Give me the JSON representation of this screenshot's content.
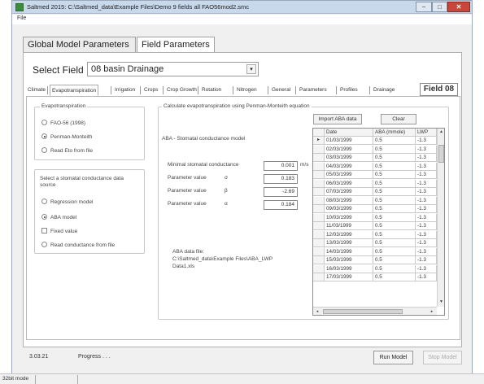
{
  "window": {
    "title": "Saltmed 2015: C:\\Saltmed_data\\Example Files\\Demo 9 fields all FAO56mod2.smc",
    "min_glyph": "−",
    "max_glyph": "□",
    "close_glyph": "✕"
  },
  "menu": {
    "file": "File"
  },
  "top_tabs": {
    "global": "Global Model Parameters",
    "field": "Field Parameters"
  },
  "select_field": {
    "label": "Select Field",
    "value": "08 basin Drainage",
    "arrow": "▾"
  },
  "sub_tabs": [
    "Climate",
    "Evapotranspiration",
    "Irrigation",
    "Crops",
    "Crop Growth",
    "Rotation",
    "Nitrogen",
    "General",
    "Parameters",
    "Profiles",
    "Drainage"
  ],
  "field_badge": "Field 08",
  "et_group": {
    "legend": "Evapotranspiration",
    "options": [
      "FAO-56 (1998)",
      "Penman-Monteith",
      "Read Eto from file"
    ],
    "selected_index": 1
  },
  "conductance_group": {
    "title": "Select a stomatal conductance data source",
    "options": [
      "Regression model",
      "ABA model",
      "Fixed value",
      "Read conductance from file"
    ],
    "selected_index": 1
  },
  "calc_group": {
    "legend": "Calculate evapotranspiration using Penman-Monteith equation",
    "model_title": "ABA - Stomatal conductance model",
    "params": [
      {
        "label": "Minimal stomatal conductance",
        "symbol": "",
        "value": "0.001",
        "unit": "m/s"
      },
      {
        "label": "Parameter value",
        "symbol": "σ",
        "value": "0.183",
        "unit": ""
      },
      {
        "label": "Parameter value",
        "symbol": "β",
        "value": "-2.69",
        "unit": ""
      },
      {
        "label": "Parameter value",
        "symbol": "α",
        "value": "0.184",
        "unit": ""
      }
    ],
    "aba_file_label": "ABA data file:",
    "aba_file_path_line1": "C:\\Saltmed_data\\Example Files\\ABA_LWP",
    "aba_file_path_line2": "Data1.xls",
    "import_button": "Import ABA data",
    "clear_button": "Clear"
  },
  "grid": {
    "columns": [
      "Date",
      "ABA (mmole)",
      "LWP"
    ],
    "rows": [
      {
        "date": "01/03/1999",
        "aba": "0.5",
        "lwp": "-1.3",
        "marker": "▸"
      },
      {
        "date": "02/03/1999",
        "aba": "0.5",
        "lwp": "-1.3",
        "marker": ""
      },
      {
        "date": "03/03/1999",
        "aba": "0.5",
        "lwp": "-1.3",
        "marker": ""
      },
      {
        "date": "04/03/1999",
        "aba": "0.5",
        "lwp": "-1.3",
        "marker": ""
      },
      {
        "date": "05/03/1999",
        "aba": "0.5",
        "lwp": "-1.3",
        "marker": ""
      },
      {
        "date": "06/03/1999",
        "aba": "0.5",
        "lwp": "-1.3",
        "marker": ""
      },
      {
        "date": "07/03/1999",
        "aba": "0.5",
        "lwp": "-1.3",
        "marker": ""
      },
      {
        "date": "08/03/1999",
        "aba": "0.5",
        "lwp": "-1.3",
        "marker": ""
      },
      {
        "date": "09/03/1999",
        "aba": "0.5",
        "lwp": "-1.3",
        "marker": ""
      },
      {
        "date": "10/03/1999",
        "aba": "0.5",
        "lwp": "-1.3",
        "marker": ""
      },
      {
        "date": "11/03/1999",
        "aba": "0.5",
        "lwp": "-1.3",
        "marker": ""
      },
      {
        "date": "12/03/1999",
        "aba": "0.5",
        "lwp": "-1.3",
        "marker": ""
      },
      {
        "date": "13/03/1999",
        "aba": "0.5",
        "lwp": "-1.3",
        "marker": ""
      },
      {
        "date": "14/03/1999",
        "aba": "0.5",
        "lwp": "-1.3",
        "marker": ""
      },
      {
        "date": "15/03/1999",
        "aba": "0.5",
        "lwp": "-1.3",
        "marker": ""
      },
      {
        "date": "16/03/1999",
        "aba": "0.5",
        "lwp": "-1.3",
        "marker": ""
      },
      {
        "date": "17/03/1999",
        "aba": "0.5",
        "lwp": "-1.3",
        "marker": ""
      }
    ],
    "up_glyph": "▲",
    "down_glyph": "▼",
    "left_glyph": "◂",
    "right_glyph": "▸"
  },
  "footer": {
    "version": "3.03.21",
    "progress": "Progress . . .",
    "run_button": "Run Model",
    "stop_button": "Stop Model"
  },
  "status_bar": {
    "mode": "32bit mode"
  }
}
